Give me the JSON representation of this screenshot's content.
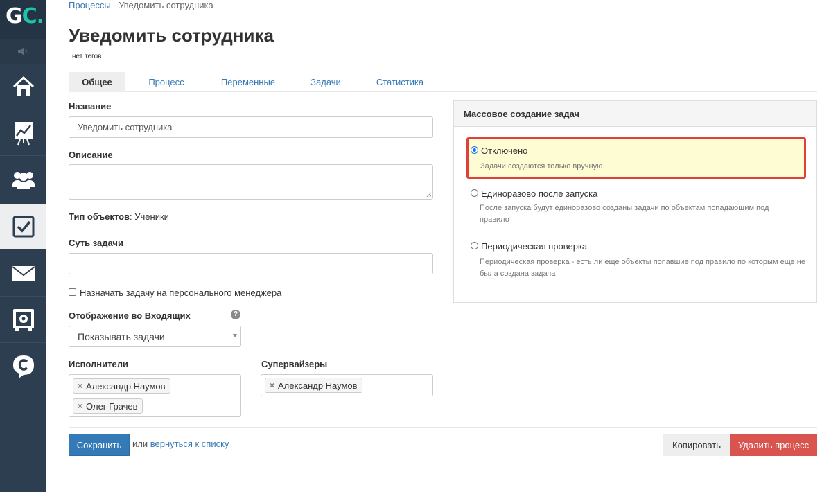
{
  "app": {
    "logo_g": "G",
    "logo_c": "C."
  },
  "sidebar": {
    "items": [
      {
        "icon": "home-icon"
      },
      {
        "icon": "chart-icon"
      },
      {
        "icon": "users-icon"
      },
      {
        "icon": "tasks-checkbox-icon",
        "active": true
      },
      {
        "icon": "mail-icon"
      },
      {
        "icon": "safe-icon"
      },
      {
        "icon": "chat-icon"
      }
    ]
  },
  "breadcrumb": {
    "parent": "Процессы",
    "separator": " - ",
    "current": "Уведомить сотрудника"
  },
  "header": {
    "title": "Уведомить сотрудника",
    "tags": "нет тегов"
  },
  "tabs": [
    {
      "label": "Общее",
      "active": true
    },
    {
      "label": "Процесс"
    },
    {
      "label": "Переменные"
    },
    {
      "label": "Задачи"
    },
    {
      "label": "Статистика"
    }
  ],
  "form": {
    "name_label": "Название",
    "name_value": "Уведомить сотрудника",
    "description_label": "Описание",
    "description_value": "",
    "object_type_label": "Тип объектов",
    "object_type_value": ": Ученики",
    "task_essence_label": "Суть задачи",
    "task_essence_value": "",
    "assign_manager_label": "Назначать задачу на персонального менеджера",
    "inbox_display_label": "Отображение во Входящих",
    "inbox_display_value": "Показывать задачи",
    "help_glyph": "?",
    "executors_label": "Исполнители",
    "executors": [
      "Александр Наумов",
      "Олег Грачев"
    ],
    "supervisors_label": "Супервайзеры",
    "supervisors": [
      "Александр Наумов"
    ],
    "chip_remove_glyph": "×"
  },
  "footer": {
    "save_label": "Сохранить",
    "or_text": "или ",
    "back_link": "вернуться к списку",
    "copy_label": "Копировать",
    "delete_label": "Удалить процесс"
  },
  "mass_panel": {
    "title": "Массовое создание задач",
    "options": [
      {
        "label": "Отключено",
        "desc": "Задачи создаются только вручную",
        "checked": true
      },
      {
        "label": "Единоразово после запуска",
        "desc": "После запуска будут единоразово созданы задачи по объектам попадающим под правило"
      },
      {
        "label": "Периодическая проверка",
        "desc": "Периодическая проверка - есть ли еще объекты попавшие под правило по которым еще не была создана задача"
      }
    ]
  },
  "colors": {
    "sidebar": "#2d3e50",
    "accent": "#337ab7",
    "danger": "#d9534f",
    "highlight_border": "#e0403a",
    "highlight_bg": "#fdfcd3"
  }
}
